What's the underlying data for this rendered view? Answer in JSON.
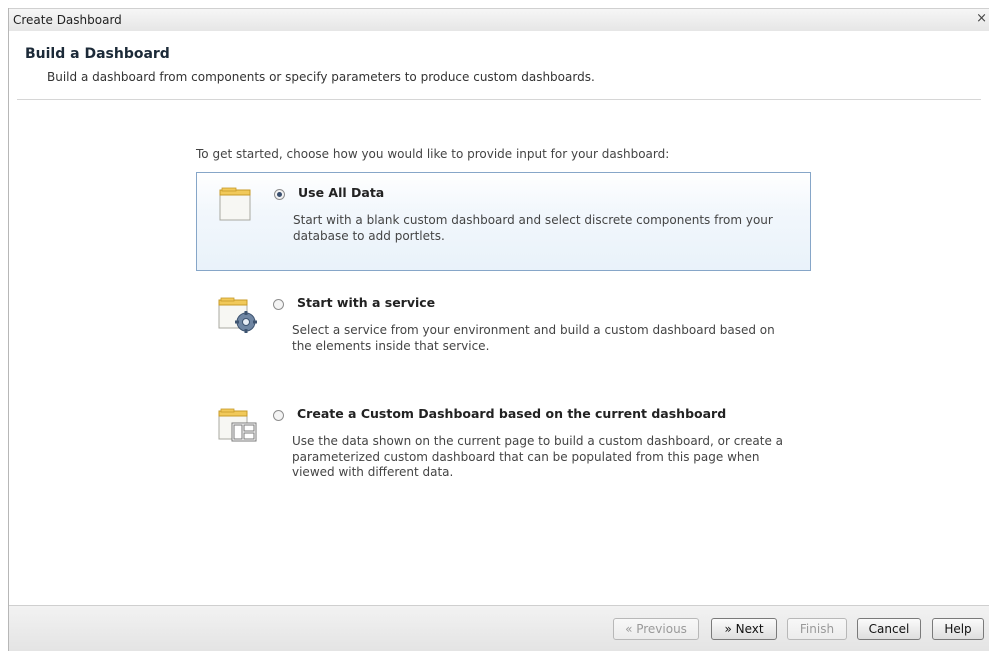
{
  "window": {
    "title": "Create Dashboard",
    "close_glyph": "×"
  },
  "header": {
    "title": "Build a Dashboard",
    "subtitle": "Build a dashboard from components or specify parameters to produce custom dashboards."
  },
  "intro": "To get started, choose how you would like to provide input for your dashboard:",
  "options": [
    {
      "label": "Use All Data",
      "desc": "Start with a blank custom dashboard and select discrete components from your database to add portlets.",
      "icon": "blank-page-icon",
      "selected": true
    },
    {
      "label": "Start with a service",
      "desc": "Select a service from your environment and build a custom dashboard based on the elements inside that service.",
      "icon": "service-gear-icon",
      "selected": false
    },
    {
      "label": "Create a Custom Dashboard based on the current dashboard",
      "desc": "Use the data shown on the current page to build a custom dashboard, or create a parameterized custom dashboard that can be populated from this page when viewed with different data.",
      "icon": "layout-page-icon",
      "selected": false
    }
  ],
  "buttons": {
    "previous": "« Previous",
    "next": "» Next",
    "finish": "Finish",
    "cancel": "Cancel",
    "help": "Help"
  },
  "colors": {
    "selected_border": "#86a6c8",
    "selected_bg": "#e9f2fa"
  }
}
